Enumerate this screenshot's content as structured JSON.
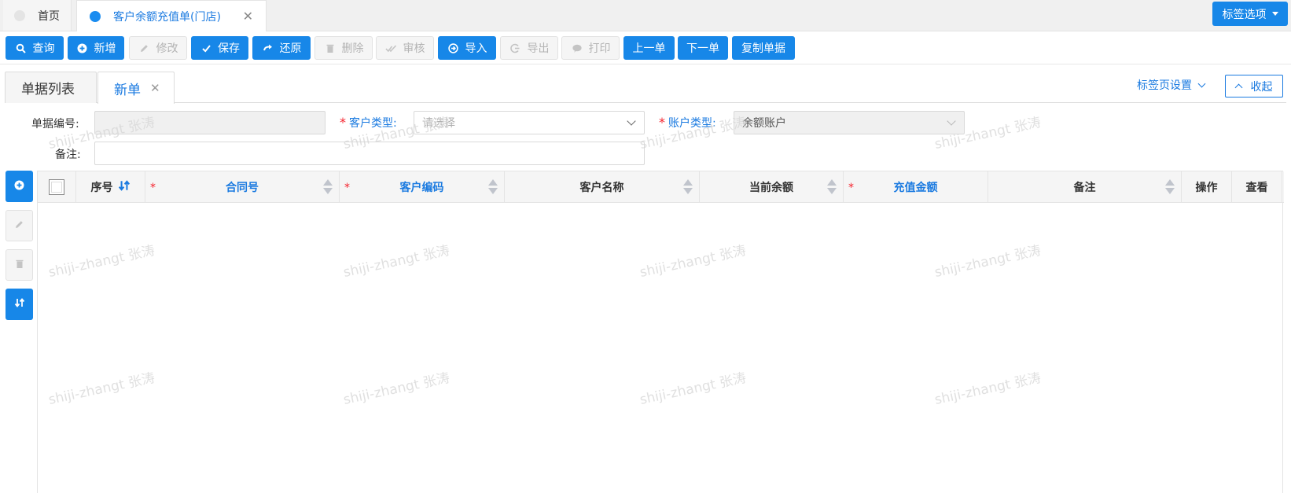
{
  "app_tabs": [
    {
      "label": "首页",
      "active": false
    },
    {
      "label": "客户余额充值单(门店)",
      "active": true
    }
  ],
  "tag_options_label": "标签选项",
  "toolbar": [
    {
      "label": "查询",
      "icon": "search-icon",
      "enabled": true
    },
    {
      "label": "新增",
      "icon": "plus-circle-icon",
      "enabled": true
    },
    {
      "label": "修改",
      "icon": "pencil-icon",
      "enabled": false
    },
    {
      "label": "保存",
      "icon": "check-icon",
      "enabled": true
    },
    {
      "label": "还原",
      "icon": "redo-icon",
      "enabled": true
    },
    {
      "label": "删除",
      "icon": "trash-icon",
      "enabled": false
    },
    {
      "label": "审核",
      "icon": "double-check-icon",
      "enabled": false
    },
    {
      "label": "导入",
      "icon": "import-icon",
      "enabled": true
    },
    {
      "label": "导出",
      "icon": "export-icon",
      "enabled": false
    },
    {
      "label": "打印",
      "icon": "print-icon",
      "enabled": false
    },
    {
      "label": "上一单",
      "icon": "",
      "enabled": true
    },
    {
      "label": "下一单",
      "icon": "",
      "enabled": true
    },
    {
      "label": "复制单据",
      "icon": "",
      "enabled": true
    }
  ],
  "sub_tabs": {
    "list": "单据列表",
    "new": "新单"
  },
  "tab_settings": "标签页设置",
  "collapse": "收起",
  "form": {
    "doc_no_label": "单据编号:",
    "doc_no_value": "",
    "customer_type_label": "客户类型:",
    "customer_type_placeholder": "请选择",
    "account_type_label": "账户类型:",
    "account_type_value": "余额账户",
    "remark_label": "备注:",
    "remark_value": ""
  },
  "grid": {
    "columns": [
      {
        "label": "",
        "type": "checkbox"
      },
      {
        "label": "序号",
        "required": false,
        "sortable": false
      },
      {
        "label": "合同号",
        "required": true,
        "sortable": true
      },
      {
        "label": "客户编码",
        "required": true,
        "sortable": true
      },
      {
        "label": "客户名称",
        "required": false,
        "sortable": true
      },
      {
        "label": "当前余额",
        "required": false,
        "sortable": true
      },
      {
        "label": "充值金额",
        "required": true,
        "sortable": false
      },
      {
        "label": "备注",
        "required": false,
        "sortable": true
      },
      {
        "label": "操作",
        "required": false,
        "sortable": false
      },
      {
        "label": "查看",
        "required": false,
        "sortable": false
      }
    ],
    "rows": []
  },
  "watermark": "shiji-zhangt 张涛",
  "colors": {
    "primary": "#1787e8",
    "required": "#f5222d",
    "link": "#1a7ae0"
  }
}
